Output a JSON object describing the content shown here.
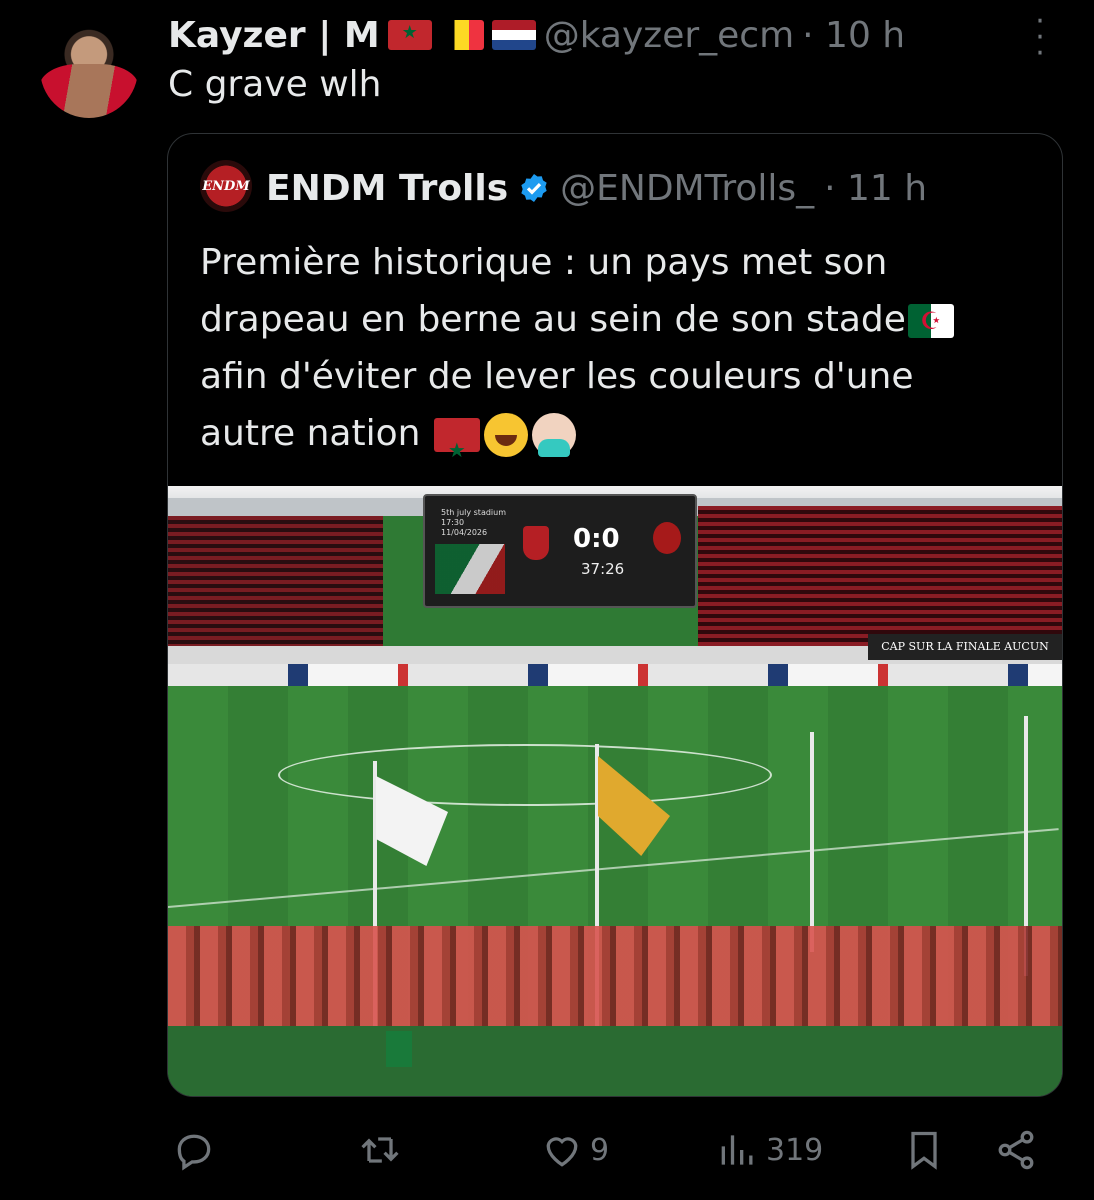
{
  "reply": {
    "author_name": "Kayzer | M",
    "author_flags": [
      "morocco-flag",
      "belgium-flag",
      "netherlands-flag"
    ],
    "handle": "@kayzer_ecm",
    "time": "· 10 h",
    "text": "C grave wlh"
  },
  "quoted": {
    "author_name": "ENDM Trolls",
    "avatar_text": "ENDM",
    "handle": "@ENDMTrolls_",
    "time": "· 11 h",
    "text_line1": "Première historique : un pays met son",
    "text_line2": "drapeau en berne au sein de son stade",
    "text_line3": "afin d'éviter de lever les couleurs d'une",
    "text_line4": "autre nation",
    "media": {
      "scoreboard_info": "5th july stadium\n17:30\n11/04/2026",
      "score": "0:0",
      "clock": "37:26",
      "banner": "CAP SUR LA FINALE AUCUN DROIT À L'"
    }
  },
  "actions": {
    "reply_count": "",
    "retweet_count": "",
    "like_count": "9",
    "views_count": "319"
  },
  "colors": {
    "background": "#000000",
    "text_primary": "#e7e9ea",
    "text_secondary": "#71767b",
    "verified": "#1d9bf0",
    "border": "#2f3336"
  }
}
